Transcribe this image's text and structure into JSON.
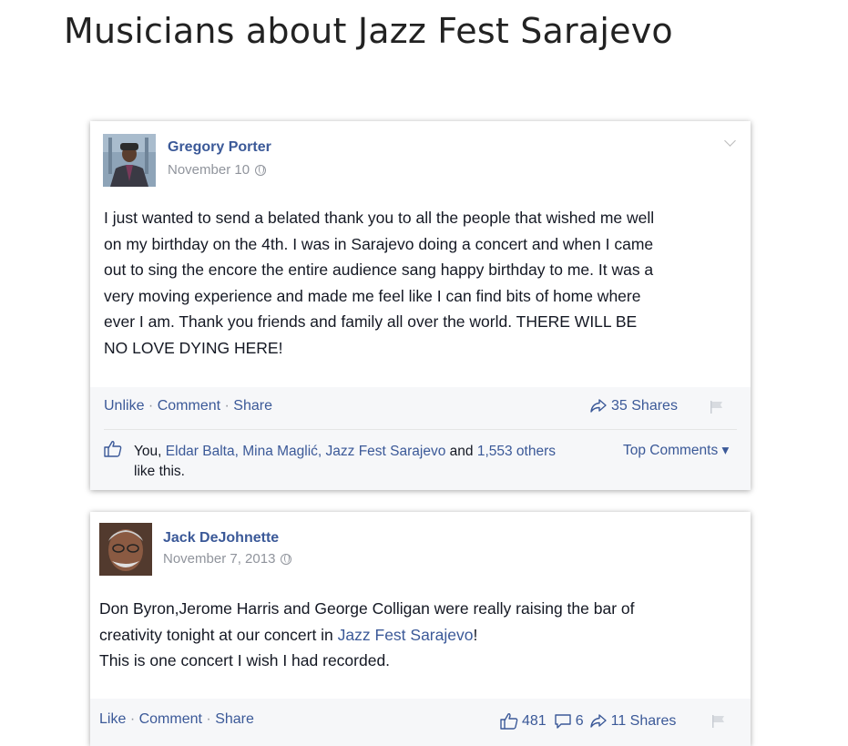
{
  "page": {
    "title": "Musicians about Jazz Fest Sarajevo"
  },
  "posts": [
    {
      "author": "Gregory Porter",
      "date": "November 10",
      "lines": [
        "I just wanted to send a belated thank you to all the people that wished me well",
        "on my birthday on the 4th. I was in Sarajevo doing a concert and when I came",
        "out to sing the encore the entire audience sang happy birthday to me. It was a",
        "very moving experience and made me feel like I can find bits of home where",
        "ever I am. Thank you friends and family all over the world. THERE WILL BE",
        "NO LOVE DYING HERE!"
      ],
      "actions": {
        "primary": "Unlike",
        "comment": "Comment",
        "share": "Share",
        "sep": "·"
      },
      "shares": "35 Shares",
      "likes": {
        "you": "You,",
        "names": "Eldar Balta, Mina Maglić, Jazz Fest Sarajevo",
        "and": "and",
        "others": "1,553 others",
        "suffix": "like this."
      },
      "top_comments": "Top Comments ▾"
    },
    {
      "author": "Jack DeJohnette",
      "date": "November 7, 2013",
      "line1": "Don Byron,Jerome Harris and George Colligan were really raising the bar of",
      "line2_pre": "creativity tonight at our concert in ",
      "line2_link": "Jazz Fest Sarajevo",
      "line2_post": "!",
      "line3": "This is one concert I wish I had recorded.",
      "actions": {
        "primary": "Like",
        "comment": "Comment",
        "share": "Share",
        "sep": "·"
      },
      "like_count": "481",
      "comment_count": "6",
      "shares": "11 Shares"
    }
  ],
  "colors": {
    "link": "#3b5998",
    "muted": "#90949c",
    "text": "#141823"
  }
}
